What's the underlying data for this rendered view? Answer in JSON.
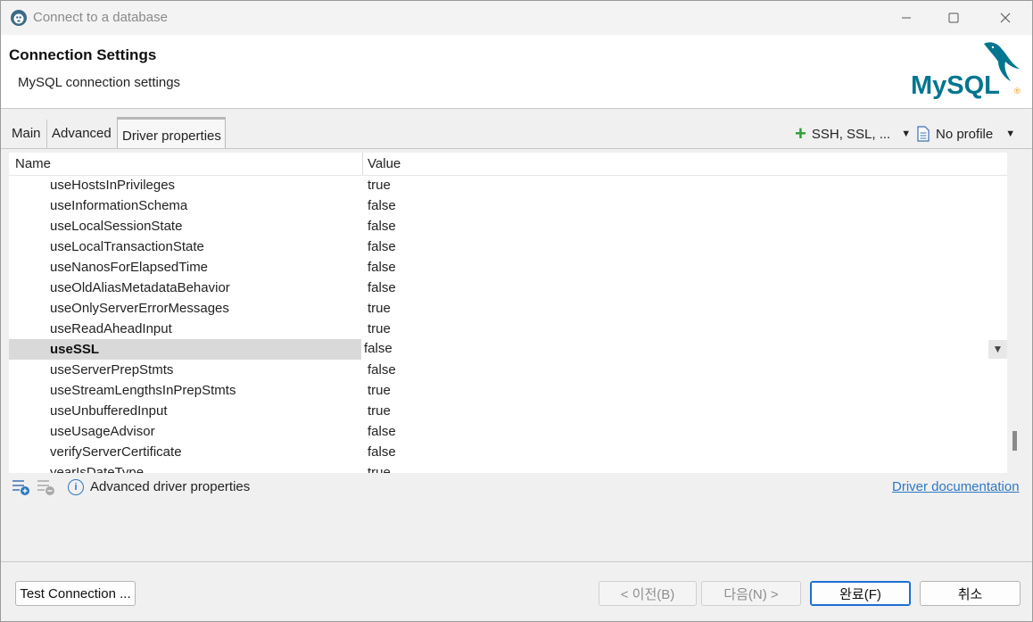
{
  "window": {
    "title": "Connect to a database"
  },
  "banner": {
    "title": "Connection Settings",
    "subtitle": "MySQL connection settings",
    "logo_text": "MySQL"
  },
  "tabs": [
    {
      "label": "Main"
    },
    {
      "label": "Advanced"
    },
    {
      "label": "Driver properties",
      "active": true
    }
  ],
  "toolbar": {
    "ssh_label": "SSH, SSL, ...",
    "profile_label": "No profile"
  },
  "table": {
    "columns": [
      "Name",
      "Value"
    ],
    "rows": [
      {
        "name": "useHostsInPrivileges",
        "value": "true"
      },
      {
        "name": "useInformationSchema",
        "value": "false"
      },
      {
        "name": "useLocalSessionState",
        "value": "false"
      },
      {
        "name": "useLocalTransactionState",
        "value": "false"
      },
      {
        "name": "useNanosForElapsedTime",
        "value": "false"
      },
      {
        "name": "useOldAliasMetadataBehavior",
        "value": "false"
      },
      {
        "name": "useOnlyServerErrorMessages",
        "value": "true"
      },
      {
        "name": "useReadAheadInput",
        "value": "true"
      },
      {
        "name": "useSSL",
        "value": "false",
        "selected": true
      },
      {
        "name": "useServerPrepStmts",
        "value": "false"
      },
      {
        "name": "useStreamLengthsInPrepStmts",
        "value": "true"
      },
      {
        "name": "useUnbufferedInput",
        "value": "true"
      },
      {
        "name": "useUsageAdvisor",
        "value": "false"
      },
      {
        "name": "verifyServerCertificate",
        "value": "false"
      },
      {
        "name": "yearIsDateType",
        "value": "true"
      }
    ]
  },
  "bottom": {
    "advanced_label": "Advanced driver properties",
    "doc_link": "Driver documentation"
  },
  "buttons": {
    "test": "Test Connection ...",
    "prev": "< 이전(B)",
    "next": "다음(N) >",
    "finish": "완료(F)",
    "cancel": "취소"
  },
  "colors": {
    "accent": "#1d6fd1",
    "link": "#2f78c4",
    "plus": "#2e9e36",
    "selection": "#d9d9d9",
    "mysql_blue": "#00758f",
    "mysql_orange": "#f29111"
  }
}
